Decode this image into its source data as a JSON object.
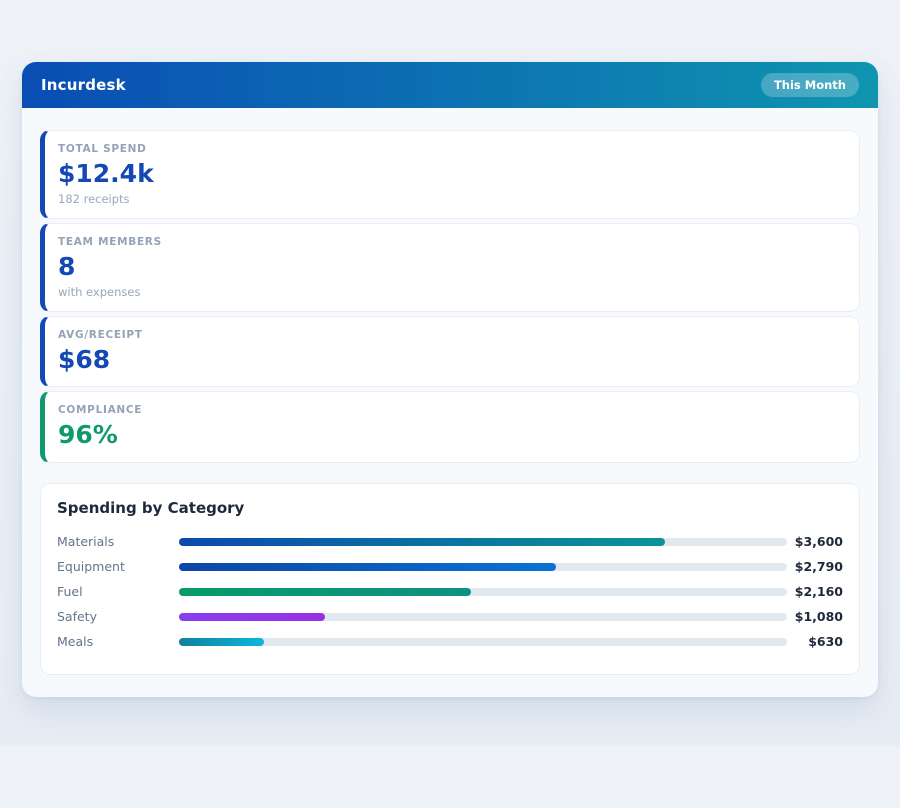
{
  "header": {
    "title": "Incurdesk",
    "badge": "This Month",
    "gradient_start": "#0a4db4",
    "gradient_end": "#0f95b0"
  },
  "stats": [
    {
      "label": "TOTAL SPEND",
      "value": "$12.4k",
      "sub": "182 receipts",
      "accent": "#1448b5"
    },
    {
      "label": "TEAM MEMBERS",
      "value": "8",
      "sub": "with expenses",
      "accent": "#1448b5"
    },
    {
      "label": "AVG/RECEIPT",
      "value": "$68",
      "sub": "",
      "accent": "#1448b5"
    },
    {
      "label": "COMPLIANCE",
      "value": "96%",
      "sub": "",
      "accent": "#0f9a6b"
    }
  ],
  "chart_data": {
    "type": "bar",
    "orientation": "horizontal",
    "title": "Spending by Category",
    "categories": [
      "Materials",
      "Equipment",
      "Fuel",
      "Safety",
      "Meals"
    ],
    "values": [
      3600,
      2790,
      2160,
      1080,
      630
    ],
    "value_labels": [
      "$3,600",
      "$2,790",
      "$2,160",
      "$1,080",
      "$630"
    ],
    "axis_max": 4500,
    "grid": false,
    "legend": false,
    "track_color": "#e2e8f0",
    "bar_gradients": [
      [
        "#0b49ad",
        "#0b9598"
      ],
      [
        "#0b46a8",
        "#0a72d6"
      ],
      [
        "#089a68",
        "#0e9184"
      ],
      [
        "#8a3ef0",
        "#9632e2"
      ],
      [
        "#11809d",
        "#0cb8dc"
      ]
    ]
  }
}
